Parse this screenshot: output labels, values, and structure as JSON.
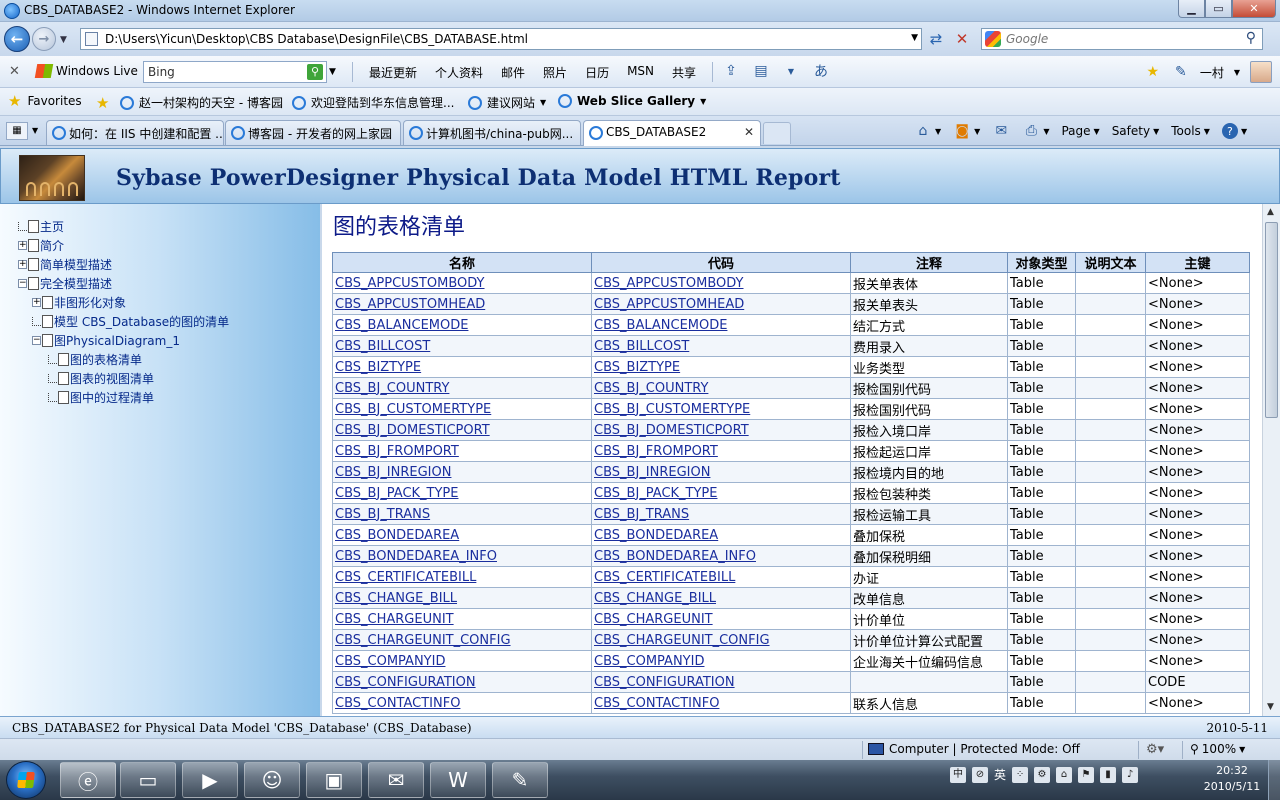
{
  "window": {
    "title": "CBS_DATABASE2 - Windows Internet Explorer",
    "min": "▁",
    "max": "▭",
    "close": "✕"
  },
  "address": {
    "url": "D:\\Users\\Yicun\\Desktop\\CBS Database\\DesignFile\\CBS_DATABASE.html",
    "search_placeholder": "Google"
  },
  "live_toolbar": {
    "brand": "Windows Live",
    "search_value": "Bing",
    "links": [
      "最近更新",
      "个人资料",
      "邮件",
      "照片",
      "日历",
      "MSN",
      "共享"
    ],
    "user": "一村"
  },
  "favorites": {
    "label": "Favorites",
    "items": [
      "赵一村架构的天空 - 博客园",
      "欢迎登陆到华东信息管理...",
      "建议网站",
      "Web Slice Gallery"
    ]
  },
  "tabs": [
    {
      "label": "如何：在 IIS 中创建和配置 ..."
    },
    {
      "label": "博客园 - 开发者的网上家园"
    },
    {
      "label": "计算机图书/china-pub网..."
    },
    {
      "label": "CBS_DATABASE2",
      "active": true
    }
  ],
  "command_bar": {
    "page": "Page",
    "safety": "Safety",
    "tools": "Tools"
  },
  "report": {
    "header_title": "Sybase PowerDesigner Physical Data Model HTML Report",
    "page_title": "图的表格清单",
    "footer_text": "CBS_DATABASE2 for Physical Data Model 'CBS_Database' (CBS_Database)",
    "footer_date": "2010-5-11"
  },
  "nav_tree": [
    {
      "label": "主页"
    },
    {
      "label": "简介"
    },
    {
      "label": "简单模型描述"
    },
    {
      "label": "完全模型描述"
    },
    {
      "label": "非图形化对象"
    },
    {
      "label": "模型  CBS_Database的图的清单"
    },
    {
      "label": "图PhysicalDiagram_1"
    },
    {
      "label": "图的表格清单"
    },
    {
      "label": "图表的视图清单"
    },
    {
      "label": "图中的过程清单"
    }
  ],
  "table": {
    "columns": [
      "名称",
      "代码",
      "注释",
      "对象类型",
      "说明文本",
      "主键"
    ],
    "rows": [
      [
        "CBS_APPCUSTOMBODY",
        "CBS_APPCUSTOMBODY",
        "报关单表体",
        "Table",
        "",
        "<None>"
      ],
      [
        "CBS_APPCUSTOMHEAD",
        "CBS_APPCUSTOMHEAD",
        "报关单表头",
        "Table",
        "",
        "<None>"
      ],
      [
        "CBS_BALANCEMODE",
        "CBS_BALANCEMODE",
        "结汇方式",
        "Table",
        "",
        "<None>"
      ],
      [
        "CBS_BILLCOST",
        "CBS_BILLCOST",
        "费用录入",
        "Table",
        "",
        "<None>"
      ],
      [
        "CBS_BIZTYPE",
        "CBS_BIZTYPE",
        "业务类型",
        "Table",
        "",
        "<None>"
      ],
      [
        "CBS_BJ_COUNTRY",
        "CBS_BJ_COUNTRY",
        "报检国别代码",
        "Table",
        "",
        "<None>"
      ],
      [
        "CBS_BJ_CUSTOMERTYPE",
        "CBS_BJ_CUSTOMERTYPE",
        "报检国别代码",
        "Table",
        "",
        "<None>"
      ],
      [
        "CBS_BJ_DOMESTICPORT",
        "CBS_BJ_DOMESTICPORT",
        "报检入境口岸",
        "Table",
        "",
        "<None>"
      ],
      [
        "CBS_BJ_FROMPORT",
        "CBS_BJ_FROMPORT",
        "报检起运口岸",
        "Table",
        "",
        "<None>"
      ],
      [
        "CBS_BJ_INREGION",
        "CBS_BJ_INREGION",
        "报检境内目的地",
        "Table",
        "",
        "<None>"
      ],
      [
        "CBS_BJ_PACK_TYPE",
        "CBS_BJ_PACK_TYPE",
        "报检包装种类",
        "Table",
        "",
        "<None>"
      ],
      [
        "CBS_BJ_TRANS",
        "CBS_BJ_TRANS",
        "报检运输工具",
        "Table",
        "",
        "<None>"
      ],
      [
        "CBS_BONDEDAREA",
        "CBS_BONDEDAREA",
        "叠加保税",
        "Table",
        "",
        "<None>"
      ],
      [
        "CBS_BONDEDAREA_INFO",
        "CBS_BONDEDAREA_INFO",
        "叠加保税明细",
        "Table",
        "",
        "<None>"
      ],
      [
        "CBS_CERTIFICATEBILL",
        "CBS_CERTIFICATEBILL",
        "办证",
        "Table",
        "",
        "<None>"
      ],
      [
        "CBS_CHANGE_BILL",
        "CBS_CHANGE_BILL",
        "改单信息",
        "Table",
        "",
        "<None>"
      ],
      [
        "CBS_CHARGEUNIT",
        "CBS_CHARGEUNIT",
        "计价单位",
        "Table",
        "",
        "<None>"
      ],
      [
        "CBS_CHARGEUNIT_CONFIG",
        "CBS_CHARGEUNIT_CONFIG",
        "计价单位计算公式配置",
        "Table",
        "",
        "<None>"
      ],
      [
        "CBS_COMPANYID",
        "CBS_COMPANYID",
        "企业海关十位编码信息",
        "Table",
        "",
        "<None>"
      ],
      [
        "CBS_CONFIGURATION",
        "CBS_CONFIGURATION",
        "",
        "Table",
        "",
        "CODE"
      ],
      [
        "CBS_CONTACTINFO",
        "CBS_CONTACTINFO",
        "联系人信息",
        "Table",
        "",
        "<None>"
      ]
    ]
  },
  "status": {
    "zone": "Computer | Protected Mode: Off",
    "zoom": "100%"
  },
  "taskbar": {
    "clock_time": "20:32",
    "clock_date": "2010/5/11",
    "ime": "英"
  }
}
